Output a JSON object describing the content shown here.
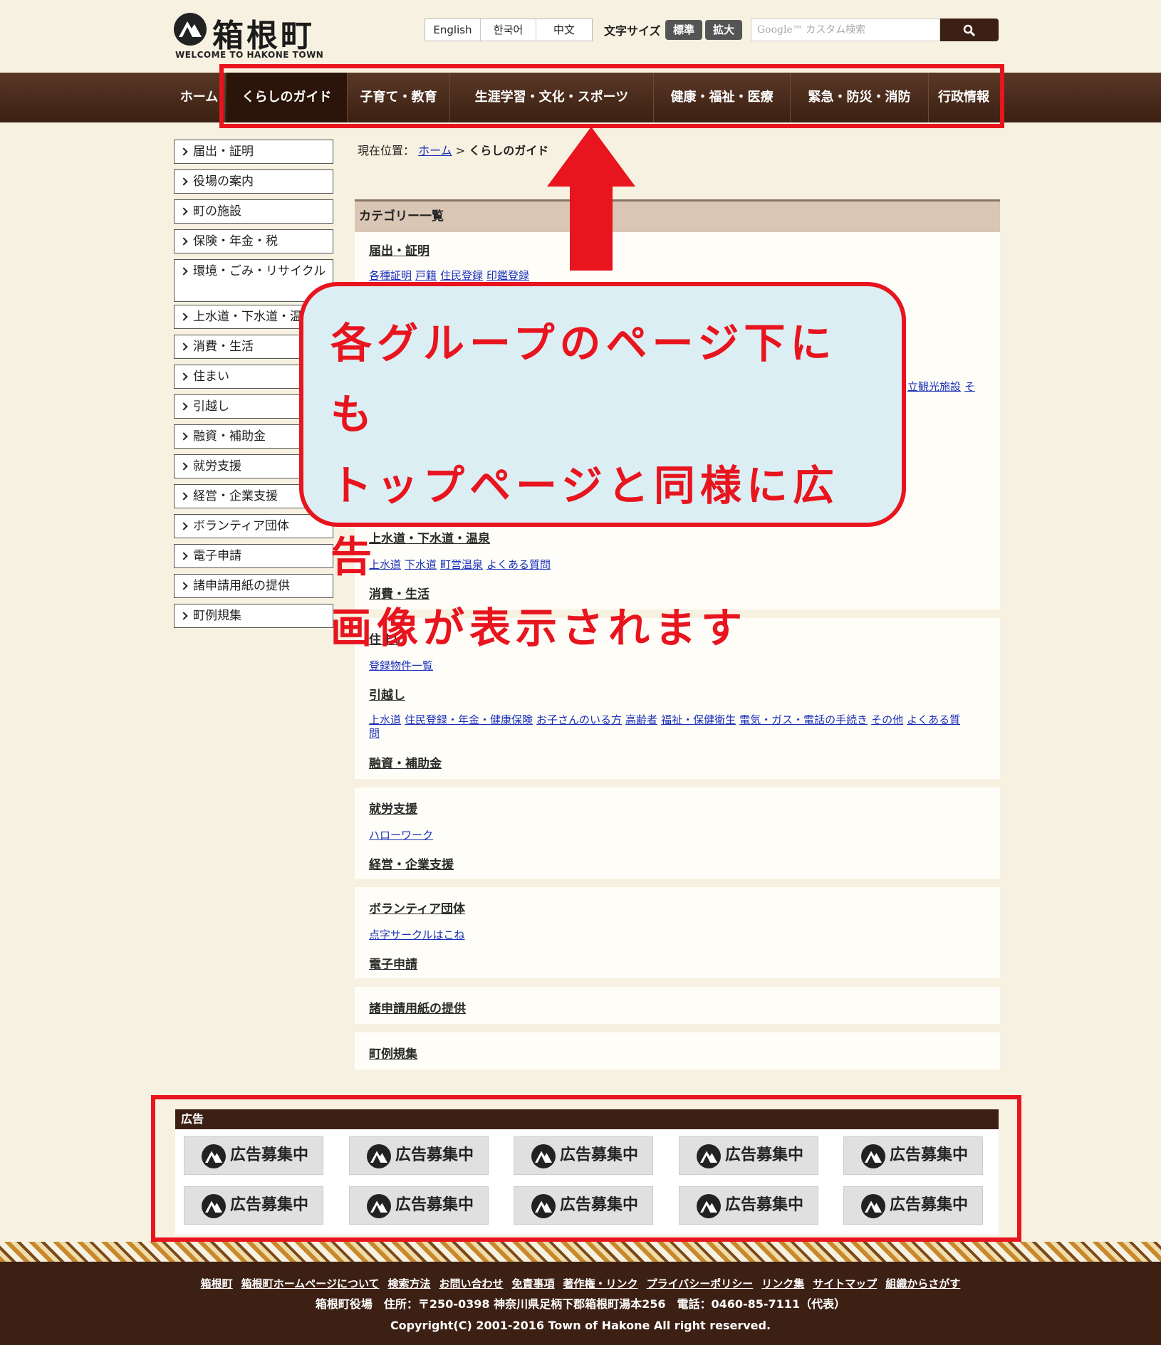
{
  "header": {
    "site_title": "箱根町",
    "site_subtitle": "WELCOME TO HAKONE TOWN",
    "languages": [
      "English",
      "한국어",
      "中文"
    ],
    "font_size_label": "文字サイズ",
    "font_size_normal": "標準",
    "font_size_large": "拡大",
    "search_placeholder": "Google™ カスタム検索"
  },
  "nav": {
    "items": [
      "ホーム",
      "くらしのガイド",
      "子育て・教育",
      "生涯学習・文化・スポーツ",
      "健康・福祉・医療",
      "緊急・防災・消防",
      "行政情報"
    ],
    "active": "くらしのガイド"
  },
  "sidebar": {
    "items": [
      "届出・証明",
      "役場の案内",
      "町の施設",
      "保険・年金・税",
      "環境・ごみ・リサイクル",
      "上水道・下水道・温泉",
      "消費・生活",
      "住まい",
      "引越し",
      "融資・補助金",
      "就労支援",
      "経営・企業支援",
      "ボランティア団体",
      "電子申請",
      "諸申請用紙の提供",
      "町例規集"
    ]
  },
  "breadcrumb": {
    "prefix": "現在位置：",
    "home": "ホーム",
    "separator": ">",
    "current": "くらしのガイド"
  },
  "categories": {
    "header": "カテゴリー一覧",
    "c1_title": "届出・証明",
    "c1_links": [
      "各種証明",
      "戸籍",
      "住民登録",
      "印鑑登録"
    ],
    "partial_links": [
      "立観光施設",
      "そ"
    ],
    "c2_title": "上水道・下水道・温泉",
    "c2_links": [
      "上水道",
      "下水道",
      "町営温泉",
      "よくある質問"
    ],
    "c3_title": "消費・生活",
    "c4_title": "住まい",
    "c4_links": [
      "登録物件一覧"
    ],
    "c5_title": "引越し",
    "c5_links": [
      "上水道",
      "住民登録・年金・健康保険",
      "お子さんのいる方",
      "高齢者",
      "福祉・保健衛生",
      "電気・ガス・電話の手続き",
      "その他",
      "よくある質"
    ],
    "c5_links_wrap": "問",
    "c6_title": "融資・補助金",
    "c7_title": "就労支援",
    "c7_links": [
      "ハローワーク"
    ],
    "c8_title": "経営・企業支援",
    "c9_title": "ボランティア団体",
    "c9_links": [
      "点字サークルはこね"
    ],
    "c10_title": "電子申請",
    "c11_title": "諸申請用紙の提供",
    "c12_title": "町例規集"
  },
  "annotation": {
    "line1": "各グループのページ下にも",
    "line2": "トップページと同様に広告",
    "line3": "画像が表示されます"
  },
  "ads": {
    "header": "広告",
    "label": "広告募集中",
    "count": 10
  },
  "footer": {
    "links": [
      "箱根町",
      "箱根町ホームページについて",
      "検索方法",
      "お問い合わせ",
      "免責事項",
      "著作権・リンク",
      "プライバシーポリシー",
      "リンク集",
      "サイトマップ",
      "組織からさがす"
    ],
    "address": "箱根町役場　住所：〒250-0398 神奈川県足柄下郡箱根町湯本256　電話：0460-85-7111（代表）",
    "copyright": "Copyright(C) 2001-2016 Town of Hakone All right reserved."
  },
  "colors": {
    "nav_brown": "#3b2013",
    "highlight_red": "#e8141e",
    "callout_bg": "#dbeef3",
    "link_blue": "#1a2fb8"
  }
}
